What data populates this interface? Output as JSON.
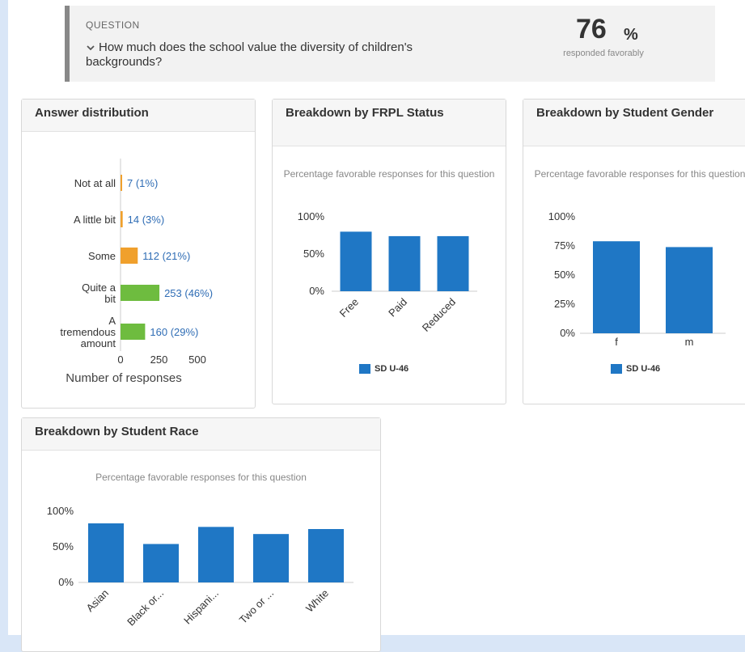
{
  "question": {
    "label": "QUESTION",
    "text": "How much does the school value the diversity of children's backgrounds?",
    "percent": "76",
    "percent_sign": "%",
    "percent_caption": "responded favorably"
  },
  "colors": {
    "bar_blue": "#1f77c5",
    "orange": "#f0a02c",
    "green": "#6ebc3f",
    "label_blue": "#2f6db5"
  },
  "chart_data": [
    {
      "type": "bar",
      "orientation": "horizontal",
      "title": "Answer distribution",
      "categories": [
        "Not at all",
        "A little bit",
        "Some",
        "Quite a bit",
        "A tremendous amount"
      ],
      "values": [
        7,
        14,
        112,
        253,
        160
      ],
      "data_labels": [
        "7 (1%)",
        "14 (3%)",
        "112 (21%)",
        "253 (46%)",
        "160 (29%)"
      ],
      "bar_colors": [
        "#f0a02c",
        "#f0a02c",
        "#f0a02c",
        "#6ebc3f",
        "#6ebc3f"
      ],
      "xlabel": "Number of responses",
      "xticks": [
        0,
        250,
        500
      ],
      "xlim": [
        0,
        500
      ]
    },
    {
      "type": "bar",
      "title": "Breakdown by FRPL Status",
      "subtitle": "Percentage favorable responses for this question",
      "categories": [
        "Free",
        "Paid",
        "Reduced"
      ],
      "series": [
        {
          "name": "SD U-46",
          "values": [
            80,
            74,
            74
          ]
        }
      ],
      "yticks": [
        "0%",
        "50%",
        "100%"
      ],
      "ylim": [
        0,
        100
      ]
    },
    {
      "type": "bar",
      "title": "Breakdown by Student Gender",
      "subtitle": "Percentage favorable responses for this question",
      "categories": [
        "f",
        "m"
      ],
      "series": [
        {
          "name": "SD U-46",
          "values": [
            79,
            74
          ]
        }
      ],
      "yticks": [
        "0%",
        "25%",
        "50%",
        "75%",
        "100%"
      ],
      "ylim": [
        0,
        100
      ]
    },
    {
      "type": "bar",
      "title": "Breakdown by Student Race",
      "subtitle": "Percentage favorable responses for this question",
      "categories": [
        "Asian",
        "Black or...",
        "Hispani...",
        "Two or ...",
        "White"
      ],
      "series": [
        {
          "name": "SD U-46",
          "values": [
            83,
            54,
            78,
            68,
            75
          ]
        }
      ],
      "yticks": [
        "0%",
        "50%",
        "100%"
      ],
      "ylim": [
        0,
        100
      ]
    }
  ]
}
